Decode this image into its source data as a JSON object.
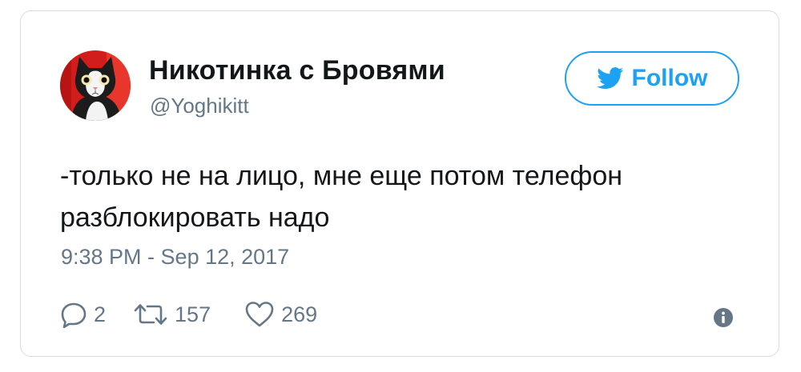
{
  "tweet": {
    "author": {
      "display_name": "Никотинка с Бровями",
      "handle": "@Yoghikitt",
      "avatar": "cat-avatar"
    },
    "follow_button": {
      "label": "Follow",
      "icon": "twitter-bird-icon"
    },
    "text_lines": [
      "-только не на лицо, мне еще потом телефон",
      "разблокировать надо"
    ],
    "timestamp": "9:38 PM - Sep 12, 2017",
    "actions": {
      "replies": {
        "icon": "reply-icon",
        "count": "2"
      },
      "retweets": {
        "icon": "retweet-icon",
        "count": "157"
      },
      "likes": {
        "icon": "heart-icon",
        "count": "269"
      },
      "info": {
        "icon": "info-icon"
      }
    }
  },
  "colors": {
    "accent": "#1da1f2",
    "text": "#14171a",
    "muted": "#657786",
    "border": "#d7dde2",
    "avatar_background": "#d21d1d"
  }
}
